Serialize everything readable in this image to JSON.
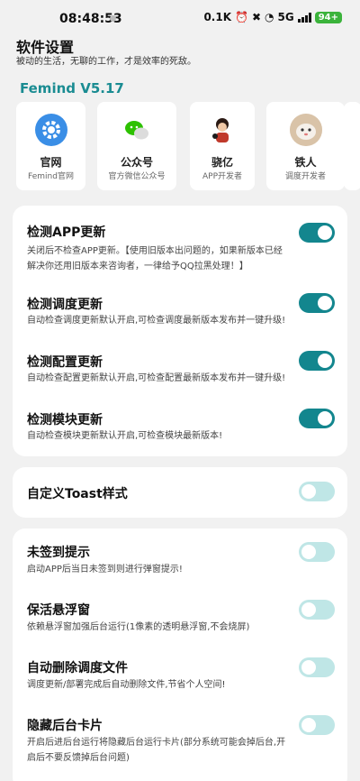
{
  "status_bar": {
    "time": "08:48:53",
    "net_speed": "0.1K",
    "network": "5G",
    "battery": "94+"
  },
  "header": {
    "title": "软件设置",
    "subtitle": "被动的生活，无聊的工作，才是效率的死敌。"
  },
  "version": "Femind V5.17",
  "cards": [
    {
      "name": "官网",
      "desc": "Femind官网",
      "icon": "gear-icon",
      "color": "#3a8ee6"
    },
    {
      "name": "公众号",
      "desc": "官方微信公众号",
      "icon": "wechat-icon",
      "color": "#2dc100"
    },
    {
      "name": "骁亿",
      "desc": "APP开发者",
      "icon": "avatar-icon",
      "color": "#c0392b"
    },
    {
      "name": "铁人",
      "desc": "调度开发者",
      "icon": "avatar-icon",
      "color": "#c9a27e"
    }
  ],
  "update_settings": [
    {
      "title": "检测APP更新",
      "desc": "关闭后不检查APP更新。【使用旧版本出问题的，如果新版本已经解决你还用旧版本来咨询者，一律给予QQ拉黑处理！】",
      "enabled": true
    },
    {
      "title": "检测调度更新",
      "desc": "自动检查调度更新默认开启,可检查调度最新版本发布并一键升级!",
      "enabled": true
    },
    {
      "title": "检测配置更新",
      "desc": "自动检查配置更新默认开启,可检查配置最新版本发布并一键升级!",
      "enabled": true
    },
    {
      "title": "检测模块更新",
      "desc": "自动检查模块更新默认开启,可检查模块最新版本!",
      "enabled": true
    }
  ],
  "toast_setting": {
    "title": "自定义Toast样式",
    "enabled": false
  },
  "other_settings": [
    {
      "title": "未签到提示",
      "desc": "启动APP后当日未签到则进行弹窗提示!",
      "enabled": false
    },
    {
      "title": "保活悬浮窗",
      "desc": "依赖悬浮窗加强后台运行(1像素的透明悬浮窗,不会烧屏)",
      "enabled": false
    },
    {
      "title": "自动删除调度文件",
      "desc": "调度更新/部署完成后自动删除文件,节省个人空间!",
      "enabled": false
    },
    {
      "title": "隐藏后台卡片",
      "desc": "开启后进后台运行将隐藏后台运行卡片(部分系统可能会掉后台,开启后不要反馈掉后台问题)",
      "enabled": false
    }
  ],
  "colors": {
    "accent": "#13868e",
    "toggle_off": "#bfe6e6",
    "version": "#1a8c92"
  }
}
